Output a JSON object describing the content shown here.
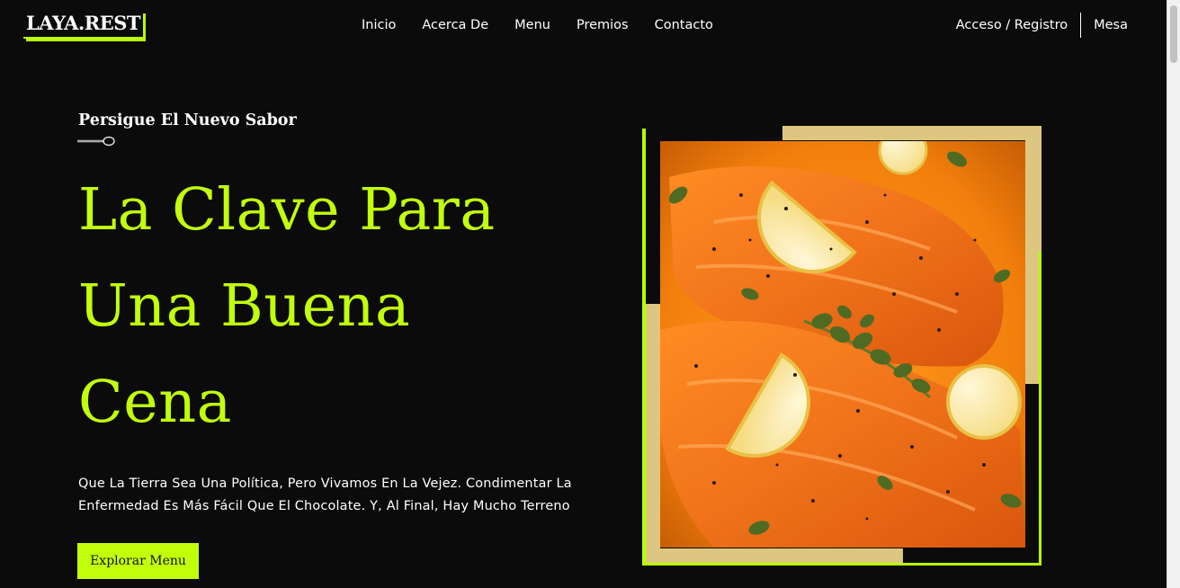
{
  "header": {
    "logo": "LAYA.REST",
    "nav": [
      "Inicio",
      "Acerca De",
      "Menu",
      "Premios",
      "Contacto"
    ],
    "login": "Acceso / Registro",
    "table": "Mesa"
  },
  "hero": {
    "subtitle": "Persigue El Nuevo Sabor",
    "headline": [
      "La Clave Para",
      "Una Buena",
      "Cena"
    ],
    "description_lines": [
      "Que La Tierra Sea Una Política, Pero Vivamos En La Vejez. Condimentar La",
      "Enfermedad Es Más Fácil Que El Chocolate. Y, Al Final, Hay Mucho Terreno"
    ],
    "cta": "Explorar Menu"
  },
  "colors": {
    "accent": "#c2ff0a",
    "tan": "#ddc780",
    "background": "#0b0b0c"
  },
  "icons": [
    "spoon-icon"
  ]
}
